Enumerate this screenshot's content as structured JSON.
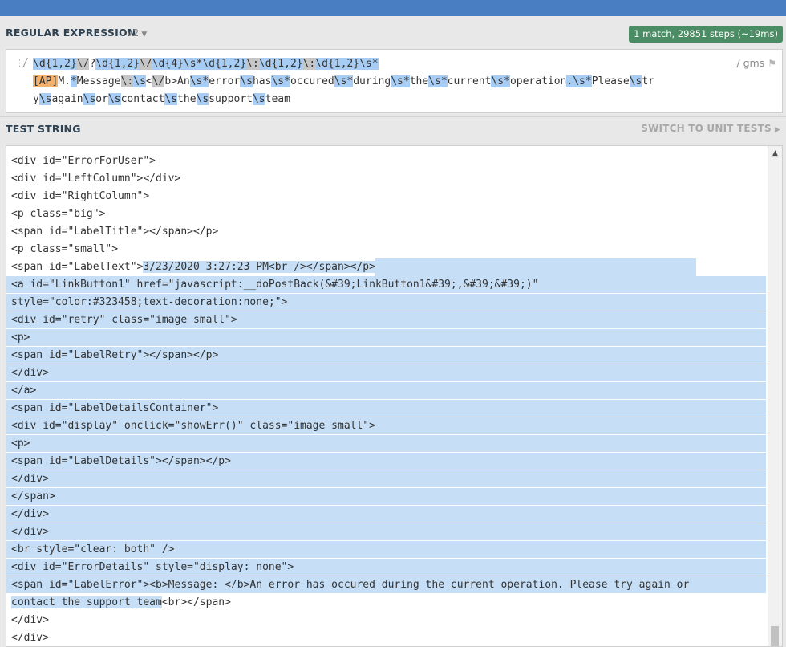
{
  "regex_section": {
    "title": "REGULAR EXPRESSION",
    "flavor": "v2",
    "match_info": "1 match, 29851 steps (~19ms)",
    "delimiter_left": "/",
    "flags": "/ gms",
    "lines": [
      [
        {
          "t": "\\d{1,2}",
          "c": "blue"
        },
        {
          "t": "\\/",
          "c": "gray"
        },
        {
          "t": "?",
          "c": ""
        },
        {
          "t": "\\d{1,2}",
          "c": "blue"
        },
        {
          "t": "\\/",
          "c": "gray"
        },
        {
          "t": "\\d{4}",
          "c": "blue"
        },
        {
          "t": "\\s*",
          "c": "blue"
        },
        {
          "t": "\\d{1,2}",
          "c": "blue"
        },
        {
          "t": "\\:",
          "c": "gray"
        },
        {
          "t": "\\d{1,2}",
          "c": "blue"
        },
        {
          "t": "\\:",
          "c": "gray"
        },
        {
          "t": "\\d{1,2}",
          "c": "blue"
        },
        {
          "t": "\\s*",
          "c": "blue"
        }
      ],
      [
        {
          "t": "[AP]",
          "c": "orange"
        },
        {
          "t": "M.",
          "c": ""
        },
        {
          "t": "*",
          "c": "blue"
        },
        {
          "t": "Message",
          "c": ""
        },
        {
          "t": "\\:",
          "c": "gray"
        },
        {
          "t": "\\s",
          "c": "blue"
        },
        {
          "t": "<",
          "c": ""
        },
        {
          "t": "\\/",
          "c": "gray"
        },
        {
          "t": "b>An",
          "c": ""
        },
        {
          "t": "\\s*",
          "c": "blue"
        },
        {
          "t": "error",
          "c": ""
        },
        {
          "t": "\\s",
          "c": "blue"
        },
        {
          "t": "has",
          "c": ""
        },
        {
          "t": "\\s*",
          "c": "blue"
        },
        {
          "t": "occured",
          "c": ""
        },
        {
          "t": "\\s*",
          "c": "blue"
        },
        {
          "t": "during",
          "c": ""
        },
        {
          "t": "\\s*",
          "c": "blue"
        },
        {
          "t": "the",
          "c": ""
        },
        {
          "t": "\\s*",
          "c": "blue"
        },
        {
          "t": "current",
          "c": ""
        },
        {
          "t": "\\s*",
          "c": "blue"
        },
        {
          "t": "operation",
          "c": ""
        },
        {
          "t": ".",
          "c": "blue"
        },
        {
          "t": "\\s*",
          "c": "blue"
        },
        {
          "t": "Please",
          "c": ""
        },
        {
          "t": "\\s",
          "c": "blue"
        },
        {
          "t": "tr",
          "c": ""
        }
      ],
      [
        {
          "t": "y",
          "c": ""
        },
        {
          "t": "\\s",
          "c": "blue"
        },
        {
          "t": "again",
          "c": ""
        },
        {
          "t": "\\s",
          "c": "blue"
        },
        {
          "t": "or",
          "c": ""
        },
        {
          "t": "\\s",
          "c": "blue"
        },
        {
          "t": "contact",
          "c": ""
        },
        {
          "t": "\\s",
          "c": "blue"
        },
        {
          "t": "the",
          "c": ""
        },
        {
          "t": "\\s",
          "c": "blue"
        },
        {
          "t": "support",
          "c": ""
        },
        {
          "t": "\\s",
          "c": "blue"
        },
        {
          "t": "team",
          "c": ""
        }
      ]
    ]
  },
  "test_section": {
    "title": "TEST STRING",
    "switch_label": "SWITCH TO UNIT TESTS",
    "lines": [
      {
        "text": "<div id=\"ErrorForUser\">",
        "hl": "none"
      },
      {
        "text": "<div id=\"ErrorForUser\">",
        "hl": "none"
      },
      {
        "text": "<div id=\"LeftColumn\"></div>",
        "hl": "none"
      },
      {
        "text": "<div id=\"RightColumn\">",
        "hl": "none"
      },
      {
        "text": "<p class=\"big\">",
        "hl": "none"
      },
      {
        "text": "<span id=\"LabelTitle\"></span></p>",
        "hl": "none"
      },
      {
        "text": "<p class=\"small\">",
        "hl": "none"
      },
      {
        "text": "<span id=\"LabelText\">",
        "hl": "partial",
        "rest": "3/23/2020 3:27:23 PM<br /></span></p>"
      },
      {
        "text": "<a id=\"LinkButton1\" href=\"javascript:__doPostBack(&#39;LinkButton1&#39;,&#39;&#39;)\"",
        "hl": "full"
      },
      {
        "text": "style=\"color:#323458;text-decoration:none;\">",
        "hl": "full"
      },
      {
        "text": "<div id=\"retry\" class=\"image small\">",
        "hl": "full"
      },
      {
        "text": "<p>",
        "hl": "full"
      },
      {
        "text": "<span id=\"LabelRetry\"></span></p>",
        "hl": "full"
      },
      {
        "text": "</div>",
        "hl": "full"
      },
      {
        "text": "</a>",
        "hl": "full"
      },
      {
        "text": "<span id=\"LabelDetailsContainer\">",
        "hl": "full"
      },
      {
        "text": "<div id=\"display\" onclick=\"showErr()\" class=\"image small\">",
        "hl": "full"
      },
      {
        "text": "<p>",
        "hl": "full"
      },
      {
        "text": "<span id=\"LabelDetails\"></span></p>",
        "hl": "full"
      },
      {
        "text": "</div>",
        "hl": "full"
      },
      {
        "text": "</span>",
        "hl": "full"
      },
      {
        "text": "</div>",
        "hl": "full"
      },
      {
        "text": "</div>",
        "hl": "full"
      },
      {
        "text": "<br style=\"clear: both\" />",
        "hl": "full"
      },
      {
        "text": "<div id=\"ErrorDetails\" style=\"display: none\">",
        "hl": "full"
      },
      {
        "text": "<span id=\"LabelError\"><b>Message: </b>An error has occured during the current operation. Please try again or",
        "hl": "full"
      },
      {
        "text": "contact the support team",
        "hl": "prefix",
        "rest": "<br></span>"
      },
      {
        "text": "</div>",
        "hl": "none"
      },
      {
        "text": "</div>",
        "hl": "none"
      }
    ]
  },
  "colors": {
    "topbar": "#4a7ec2",
    "match_badge": "#4a8c64",
    "token_quantifier": "#a8cdf5",
    "token_escape": "#c6c6c6",
    "token_charset": "#f5b06a",
    "match_highlight": "#c6dff7"
  },
  "icons": {
    "flavor_dropdown": "chevron-down-icon",
    "flags_marker": "flag-icon",
    "switch_arrow": "triangle-right-icon",
    "scroll_up": "scroll-up-arrow-icon"
  }
}
